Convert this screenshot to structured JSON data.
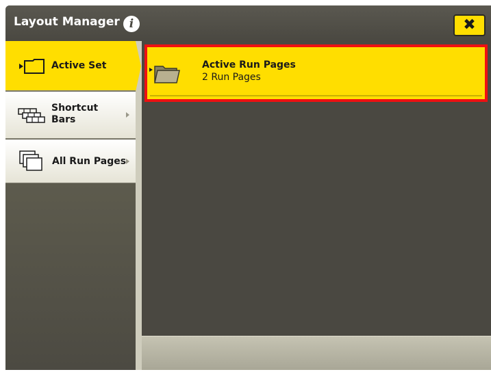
{
  "titlebar": {
    "title": "Layout Manager",
    "info_icon": "info-icon",
    "close_label": "✖"
  },
  "sidebar": {
    "items": [
      {
        "label": "Active Set",
        "icon": "active-set-icon",
        "active": true
      },
      {
        "label_line1": "Shortcut",
        "label_line2": "Bars",
        "icon": "shortcut-bars-icon",
        "active": false
      },
      {
        "label": "All Run Pages",
        "icon": "all-run-pages-icon",
        "active": false
      }
    ]
  },
  "main": {
    "cards": [
      {
        "title": "Active Run Pages",
        "subtitle": "2 Run Pages",
        "icon": "folder-icon",
        "highlighted": true
      }
    ]
  },
  "colors": {
    "accent": "#ffde00",
    "background": "#4a4841",
    "highlight_border": "#ee1111"
  }
}
